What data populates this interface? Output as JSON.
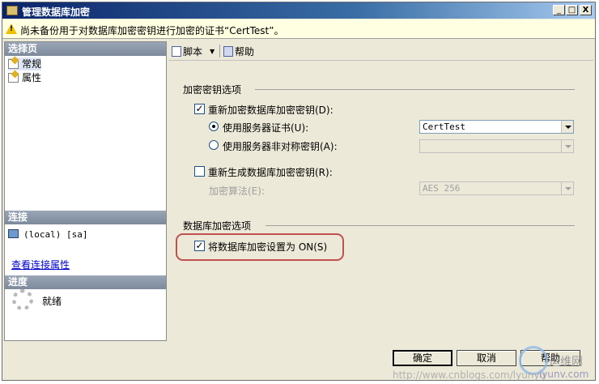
{
  "window": {
    "title": "管理数据库加密"
  },
  "title_buttons": {
    "minimize": "_",
    "maximize": "□",
    "close": "X"
  },
  "warning": {
    "text": "尚未备份用于对数据库加密密钥进行加密的证书“CertTest”。"
  },
  "sidebar": {
    "select_page_header": "选择页",
    "pages": [
      {
        "label": "常规"
      },
      {
        "label": "属性"
      }
    ],
    "connection_header": "连接",
    "connection_value": "(local) [sa]",
    "view_connection_link": "查看连接属性",
    "progress_header": "进度",
    "progress_status": "就绪"
  },
  "toolbar": {
    "script_label": "脚本",
    "script_dropdown": "▼",
    "help_label": "帮助"
  },
  "encryption_key_options": {
    "title": "加密密钥选项",
    "reencrypt_label": "重新加密数据库加密密钥(D):",
    "reencrypt_checked": true,
    "use_cert_label": "使用服务器证书(U):",
    "use_cert_value": "CertTest",
    "use_asym_label": "使用服务器非对称密钥(A):",
    "use_asym_value": "",
    "regenerate_label": "重新生成数据库加密密钥(R):",
    "regenerate_checked": false,
    "algorithm_label": "加密算法(E):",
    "algorithm_value": "AES 256"
  },
  "db_encryption_options": {
    "title": "数据库加密选项",
    "set_on_label": "将数据库加密设置为 ON(S)",
    "set_on_checked": true
  },
  "buttons": {
    "ok": "确定",
    "cancel": "取消",
    "help": "帮助"
  },
  "watermark": {
    "site": "http://www.cnblogs.com/lyunyu",
    "brand": "运维网",
    "domain": "iyunv.com"
  },
  "colors": {
    "titlebar": "#0a246a",
    "panel_header": "#8894a6",
    "warning_bg": "#ffffe1",
    "highlight": "#c05050"
  }
}
